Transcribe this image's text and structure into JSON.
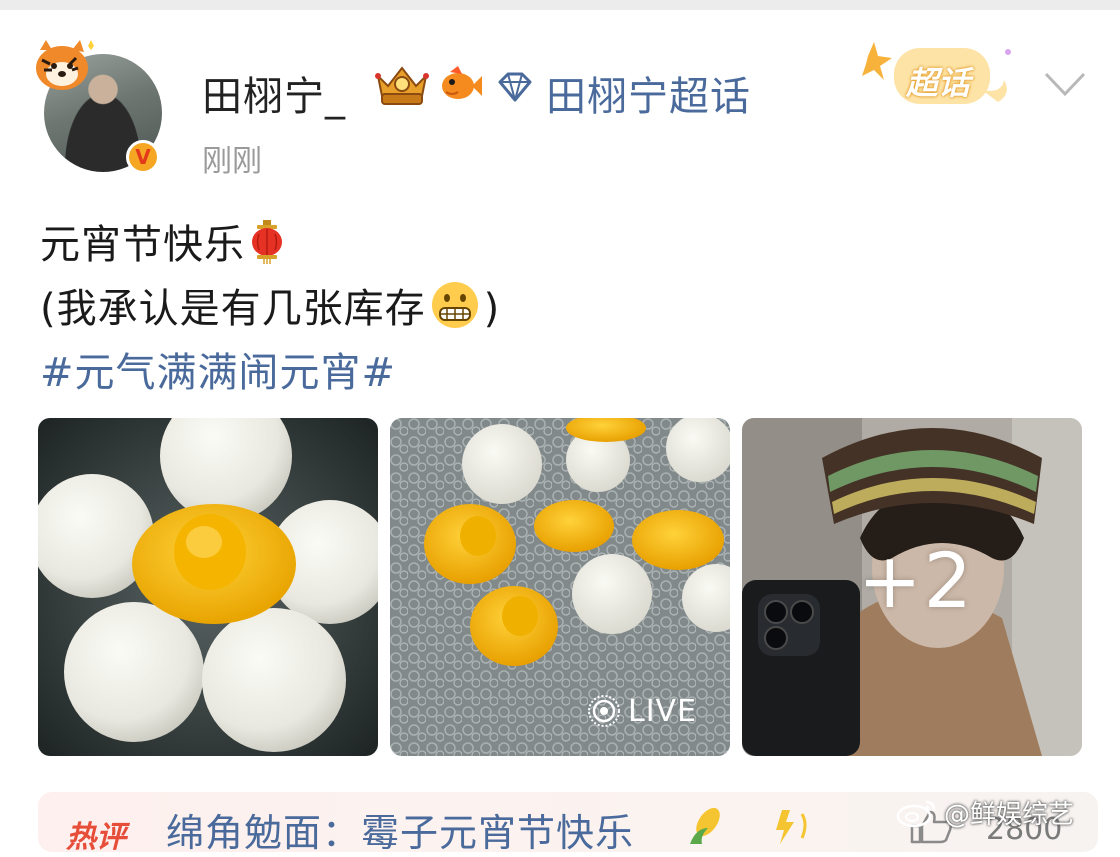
{
  "post": {
    "username": "田栩宁_",
    "super_topic": "田栩宁超话",
    "time": "刚刚",
    "chaohua_badge": "超话",
    "text_line1": "元宵节快乐",
    "text_line2_open": "(我承认是有几张库存",
    "text_line2_close": ")",
    "hashtag": "#元气满满闹元宵#",
    "emoji_1": "lantern-icon",
    "emoji_2": "grimacing-face-icon"
  },
  "photos": {
    "live_label": "LIVE",
    "more_count": "+2"
  },
  "hot": {
    "label": "热评",
    "text": "绵角勉面：霉子元宵节快乐",
    "like_count": "2800"
  },
  "watermark": {
    "text": "@鲜娱综艺"
  },
  "colors": {
    "link_blue": "#4a6a9c",
    "text_dark": "#1a1a1a",
    "muted_gray": "#9a9a9a",
    "hot_red": "#e74e3a",
    "verified_orange": "#f5a623"
  }
}
